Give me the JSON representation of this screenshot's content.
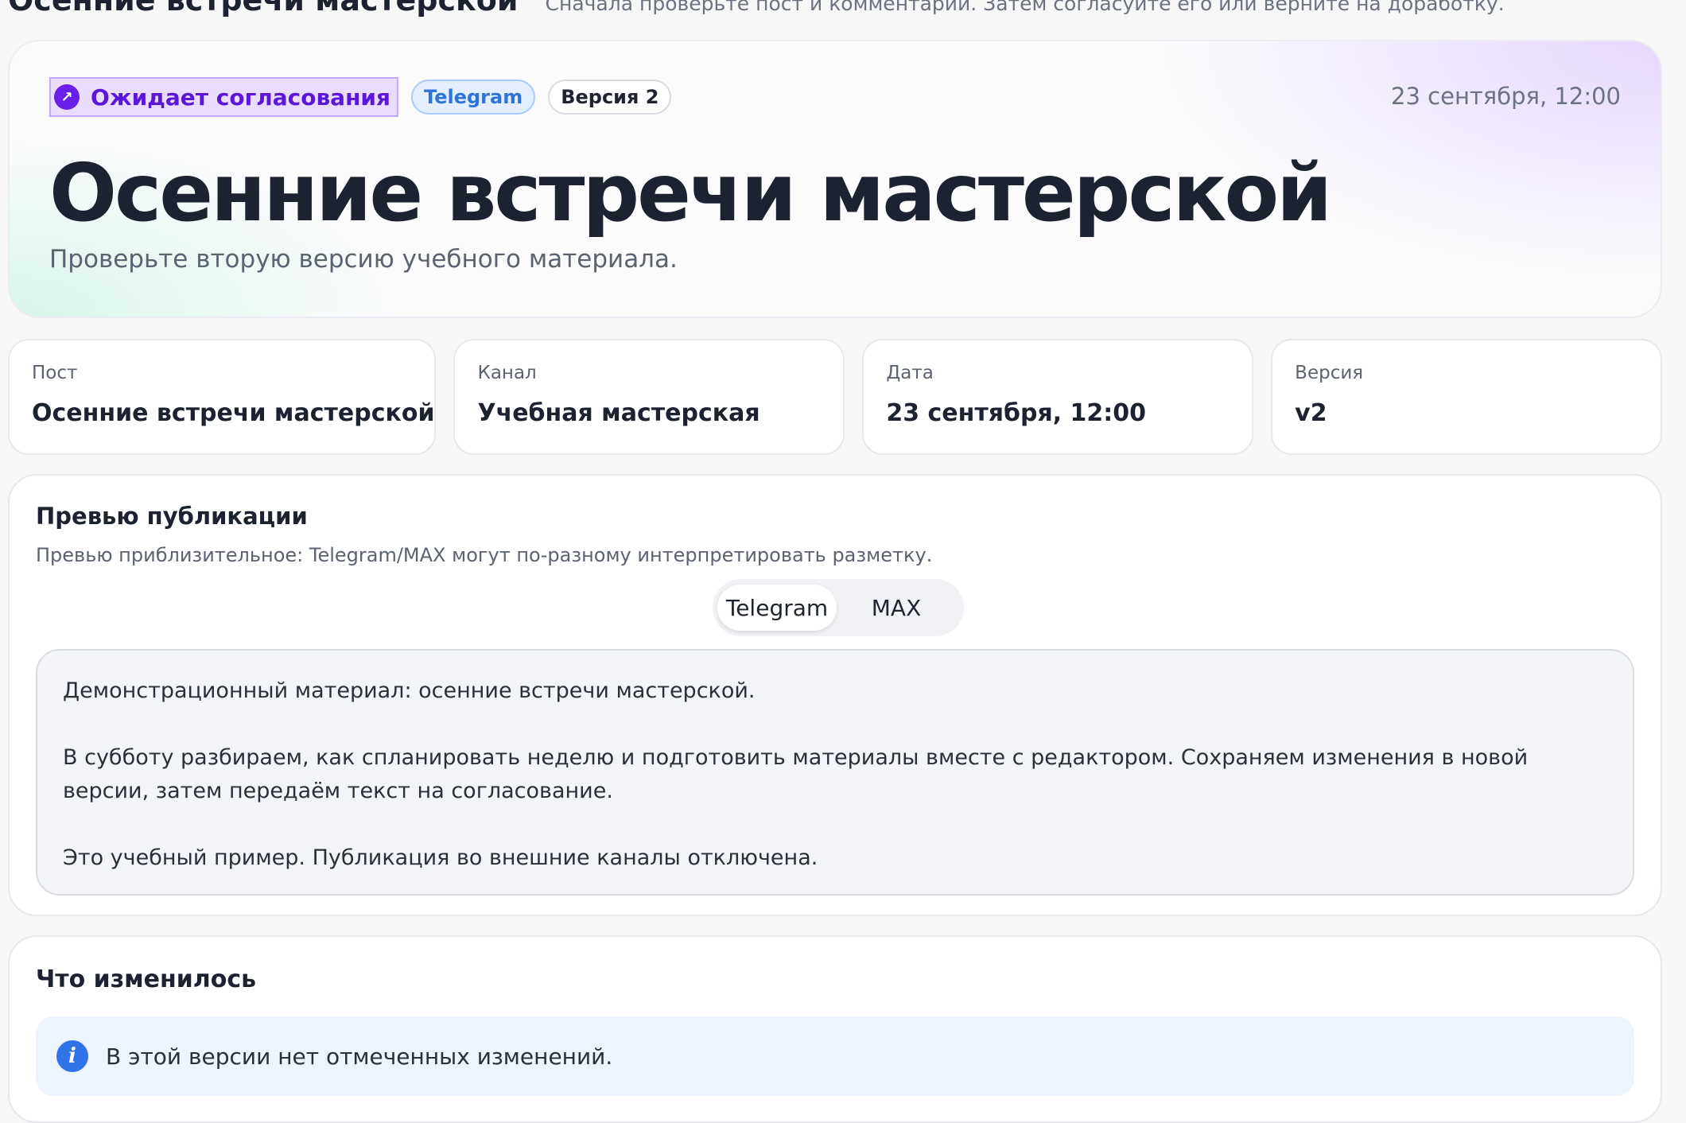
{
  "header": {
    "title": "Осенние встречи мастерской",
    "subtitle": "Сначала проверьте пост и комментарии. Затем согласуйте его или верните на доработку."
  },
  "hero": {
    "status": {
      "label": "Ожидает согласования",
      "icon": "arrow-up-right-icon",
      "color": "#6a1fe8"
    },
    "channel_badge": "Telegram",
    "version_badge": "Версия 2",
    "date": "23 сентября, 12:00",
    "title": "Осенние встречи мастерской",
    "subtitle": "Проверьте вторую версию учебного материала."
  },
  "cards": [
    {
      "label": "Пост",
      "value": "Осенние встречи мастерской"
    },
    {
      "label": "Канал",
      "value": "Учебная мастерская"
    },
    {
      "label": "Дата",
      "value": "23 сентября, 12:00"
    },
    {
      "label": "Версия",
      "value": "v2"
    }
  ],
  "preview": {
    "title": "Превью публикации",
    "note": "Превью приблизительное: Telegram/MAX могут по-разному интерпретировать разметку.",
    "tabs": [
      {
        "label": "Telegram",
        "active": true
      },
      {
        "label": "MAX",
        "active": false
      }
    ],
    "paragraphs": [
      "Демонстрационный материал: осенние встречи мастерской.",
      "В субботу разбираем, как спланировать неделю и подготовить материалы вместе с редактором. Сохраняем изменения в новой версии, затем передаём текст на согласование.",
      "Это учебный пример. Публикация во внешние каналы отключена."
    ]
  },
  "changes": {
    "title": "Что изменилось",
    "icon": "info-icon",
    "message": "В этой версии нет отмеченных изменений."
  }
}
